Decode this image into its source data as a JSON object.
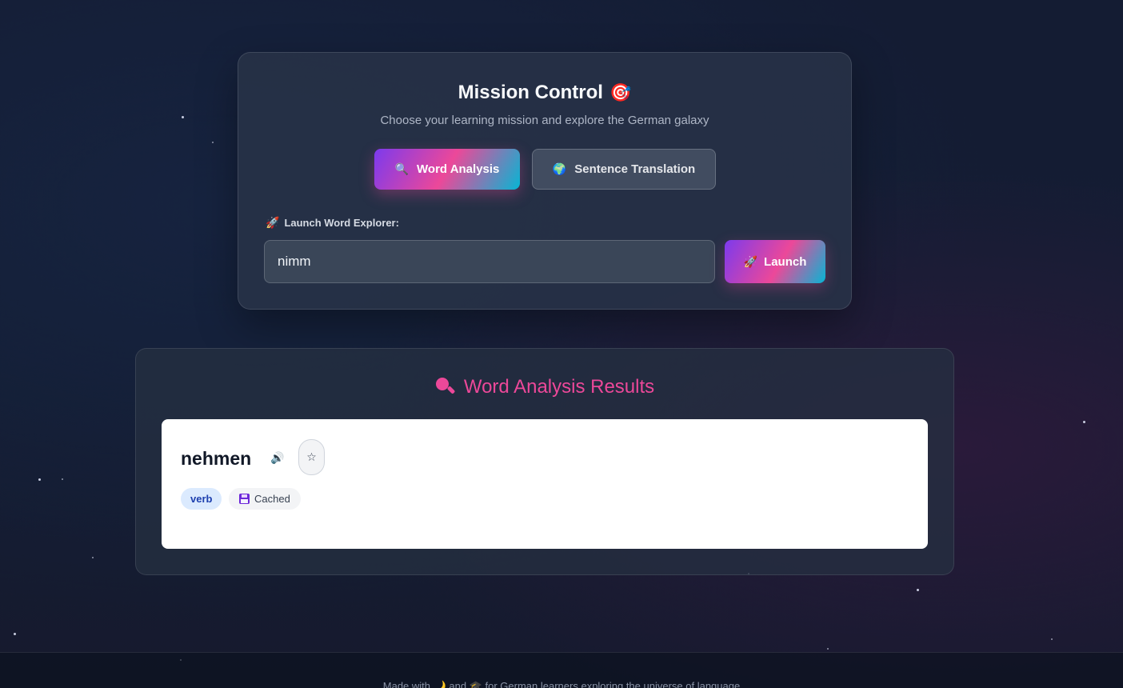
{
  "mission": {
    "title": "Mission Control",
    "title_emoji": "🎯",
    "subtitle": "Choose your learning mission and explore the German galaxy",
    "modes": [
      {
        "icon": "🔍",
        "label": "Word Analysis",
        "active": true
      },
      {
        "icon": "🌍",
        "label": "Sentence Translation",
        "active": false
      }
    ],
    "input_label_icon": "🚀",
    "input_label": "Launch Word Explorer:",
    "input_value": "nimm",
    "launch_icon": "🚀",
    "launch_label": "Launch"
  },
  "results": {
    "title": "Word Analysis Results",
    "icon": "magnifier-icon",
    "word": "nehmen",
    "speaker_icon": "🔊",
    "favorite_icon": "☆",
    "part_of_speech": "verb",
    "cache_label": "Cached"
  },
  "footer": {
    "text": "Made with 🌙 and 🎓 for German learners exploring the universe of language"
  },
  "colors": {
    "accent_pink": "#ec4899",
    "accent_purple": "#7c3aed",
    "accent_cyan": "#06b6d4"
  }
}
